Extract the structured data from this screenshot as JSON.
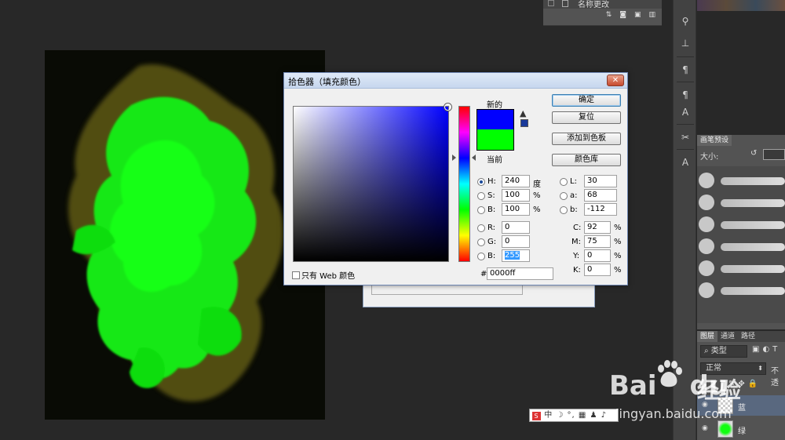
{
  "layer_comps": {
    "item_label": "名称更改"
  },
  "picker": {
    "title": "拾色器（填充颜色）",
    "close": "✕",
    "label_new": "新的",
    "label_current": "当前",
    "new_color": "#0000ff",
    "current_color": "#00ff00",
    "buttons": {
      "ok": "确定",
      "reset": "复位",
      "add_swatch": "添加到色板",
      "color_library": "颜色库"
    },
    "hsb": {
      "h_label": "H:",
      "h": "240",
      "h_unit": "度",
      "s_label": "S:",
      "s": "100",
      "s_unit": "%",
      "b_label": "B:",
      "b": "100",
      "b_unit": "%"
    },
    "rgb": {
      "r_label": "R:",
      "r": "0",
      "g_label": "G:",
      "g": "0",
      "b_label": "B:",
      "b": "255"
    },
    "lab": {
      "l_label": "L:",
      "l": "30",
      "a_label": "a:",
      "a": "68",
      "b_label": "b:",
      "b": "-112"
    },
    "cmyk": {
      "c_label": "C:",
      "c": "92",
      "c_unit": "%",
      "m_label": "M:",
      "m": "75",
      "m_unit": "%",
      "y_label": "Y:",
      "y": "0",
      "y_unit": "%",
      "k_label": "K:",
      "k": "0",
      "k_unit": "%"
    },
    "web_only": "只有 Web 颜色",
    "hex_label": "#",
    "hex": "0000ff"
  },
  "brush_panel": {
    "tab": "画笔预设",
    "size_label": "大小:"
  },
  "layers_panel": {
    "tabs": [
      "图层",
      "通道",
      "路径"
    ],
    "filter_label": "类型",
    "blend_mode": "正常",
    "opacity_label": "不透",
    "layers": [
      {
        "name": "蓝"
      },
      {
        "name": "绿"
      }
    ]
  },
  "ime": {
    "text": "中 ☽ °, ▦ ♟ ♪"
  },
  "watermark": {
    "brand": "Bai",
    "brand2": "du",
    "cn": "经验",
    "url": "jingyan.baidu.com"
  },
  "icons": {
    "close": "close-icon",
    "warning": "warning-triangle-icon",
    "web_cube": "web-safe-cube-icon"
  }
}
